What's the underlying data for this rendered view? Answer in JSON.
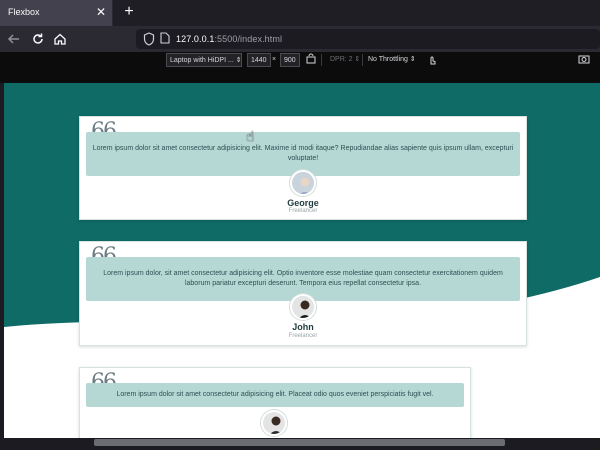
{
  "browser": {
    "tab_title": "Flexbox",
    "tab_close": "✕",
    "new_tab": "+",
    "url_host": "127.0.0.1",
    "url_rest": ":5500/index.html"
  },
  "rdm": {
    "device": "Laptop with HiDPI ...",
    "width": "1440",
    "times": "×",
    "height": "900",
    "dpr": "DPR: 2",
    "throttling": "No Throttling"
  },
  "colors": {
    "hero": "#0e6b66",
    "quote_bg": "#b5d8d5"
  },
  "testimonials": [
    {
      "quote_mark": "66",
      "text": "Lorem ipsum dolor sit amet consectetur adipisicing elit. Maxime id modi itaque? Repudiandae alias sapiente quis ipsum ullam, excepturi voluptate!",
      "name": "George",
      "role": "Freelancer"
    },
    {
      "quote_mark": "66",
      "text": "Lorem ipsum dolor, sit amet consectetur adipisicing elit. Optio inventore esse molestiae quam consectetur exercitationem quidem laborum pariatur excepturi deserunt. Tempora eius repellat consectetur ipsa.",
      "name": "John",
      "role": "Freelancer"
    },
    {
      "quote_mark": "66",
      "text": "Lorem ipsum dolor sit amet consectetur adipisicing elit. Placeat odio quos eveniet perspiciatis fugit vel.",
      "name": "",
      "role": ""
    }
  ]
}
